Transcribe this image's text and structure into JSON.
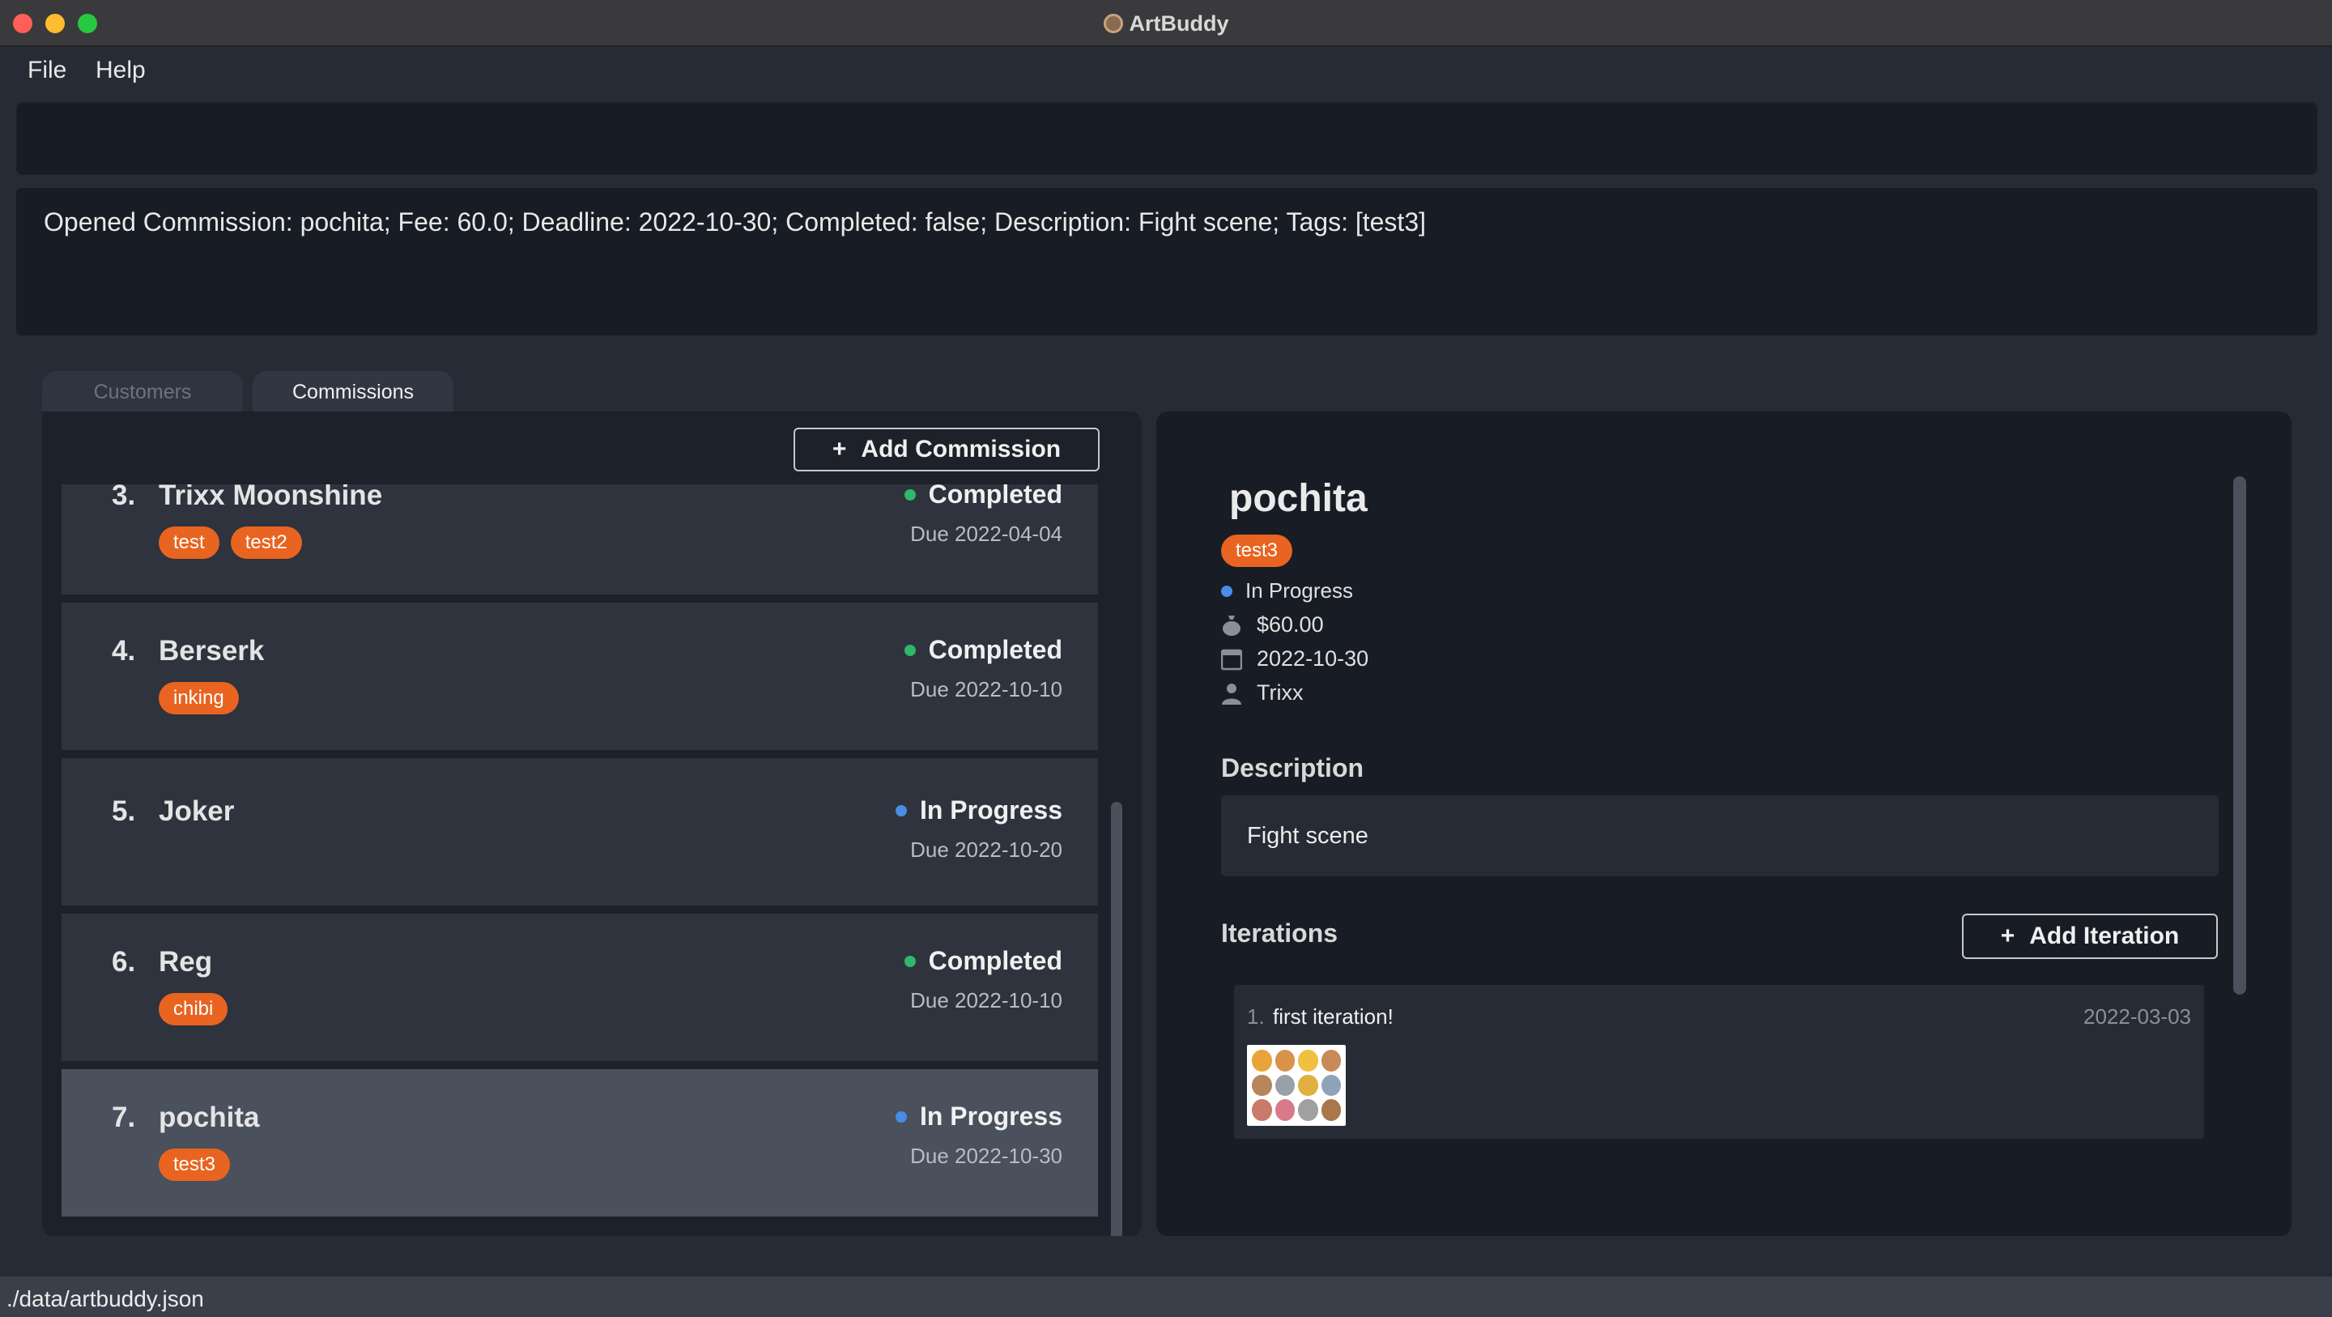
{
  "window": {
    "title": "ArtBuddy"
  },
  "menu": {
    "file": "File",
    "help": "Help"
  },
  "command": {
    "value": "",
    "placeholder": ""
  },
  "result": {
    "text": "Opened Commission: pochita; Fee: 60.0; Deadline: 2022-10-30; Completed: false; Description: Fight scene; Tags: [test3]"
  },
  "tabs": [
    {
      "label": "Customers",
      "active": false
    },
    {
      "label": "Commissions",
      "active": true
    }
  ],
  "commission_list": {
    "add_button": {
      "icon": "+",
      "label": "Add Commission"
    },
    "items": [
      {
        "index": "3.",
        "title": "Trixx Moonshine",
        "tags": [
          "test",
          "test2"
        ],
        "status": "Completed",
        "status_color": "#2fb86a",
        "due": "Due 2022-04-04",
        "selected": false
      },
      {
        "index": "4.",
        "title": "Berserk",
        "tags": [
          "inking"
        ],
        "status": "Completed",
        "status_color": "#2fb86a",
        "due": "Due 2022-10-10",
        "selected": false
      },
      {
        "index": "5.",
        "title": "Joker",
        "tags": [],
        "status": "In Progress",
        "status_color": "#4a8ce6",
        "due": "Due 2022-10-20",
        "selected": false
      },
      {
        "index": "6.",
        "title": "Reg",
        "tags": [
          "chibi"
        ],
        "status": "Completed",
        "status_color": "#2fb86a",
        "due": "Due 2022-10-10",
        "selected": false
      },
      {
        "index": "7.",
        "title": "pochita",
        "tags": [
          "test3"
        ],
        "status": "In Progress",
        "status_color": "#4a8ce6",
        "due": "Due 2022-10-30",
        "selected": true
      }
    ]
  },
  "detail": {
    "title": "pochita",
    "tags": [
      "test3"
    ],
    "status": "In Progress",
    "fee": "$60.00",
    "deadline": "2022-10-30",
    "customer": "Trixx",
    "description_heading": "Description",
    "description": "Fight scene",
    "iterations_heading": "Iterations",
    "add_iteration": {
      "icon": "+",
      "label": "Add Iteration"
    },
    "iterations": [
      {
        "index": "1.",
        "description": "first iteration!",
        "date": "2022-03-03"
      }
    ]
  },
  "statusbar": {
    "path": "./data/artbuddy.json"
  },
  "colors": {
    "accent_tag": "#e86420",
    "completed": "#2fb86a",
    "in_progress": "#4a8ce6"
  },
  "icons": {
    "fee": "money-bag-icon",
    "deadline": "calendar-icon",
    "customer": "person-icon"
  }
}
